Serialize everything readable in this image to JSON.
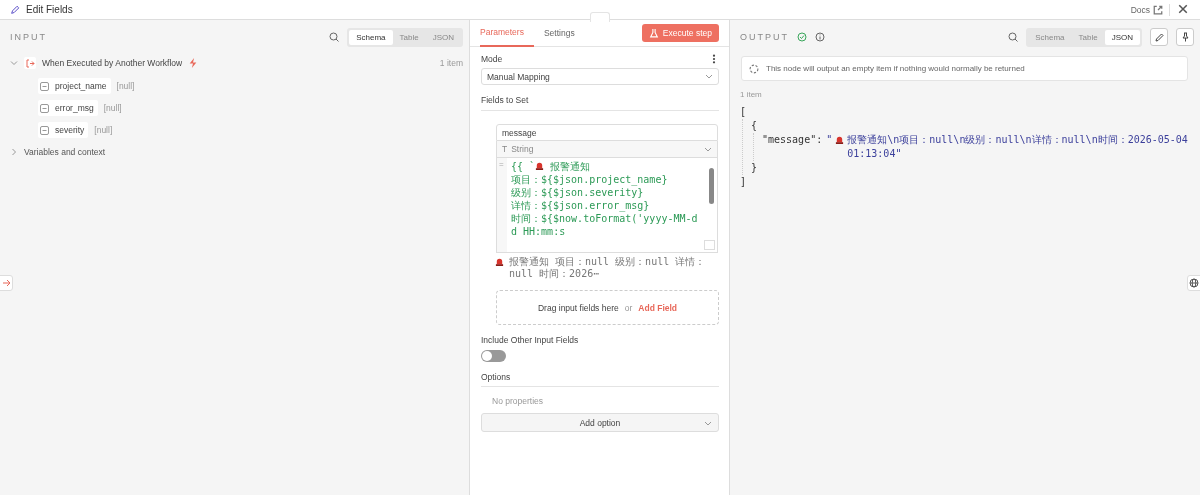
{
  "header": {
    "title": "Edit Fields",
    "docs": "Docs"
  },
  "input": {
    "title": "INPUT",
    "views": [
      {
        "label": "Schema",
        "selected": true
      },
      {
        "label": "Table",
        "selected": false
      },
      {
        "label": "JSON",
        "selected": false
      }
    ],
    "node": {
      "name": "When Executed by Another Workflow",
      "count": "1 item",
      "expanded": true,
      "fields": [
        {
          "name": "project_name",
          "value": "[null]"
        },
        {
          "name": "error_msg",
          "value": "[null]"
        },
        {
          "name": "severity",
          "value": "[null]"
        }
      ]
    },
    "context": {
      "label": "Variables and context",
      "expanded": false
    }
  },
  "parameters": {
    "tabs": [
      {
        "label": "Parameters",
        "selected": true
      },
      {
        "label": "Settings",
        "selected": false
      }
    ],
    "execute": "Execute step",
    "mode_label": "Mode",
    "mode_value": "Manual Mapping",
    "fields_label": "Fields to Set",
    "assignment": {
      "name": "message",
      "type_icon": "T",
      "type": "String",
      "eq": "=",
      "code_lines": [
        {
          "kind": "alert",
          "before": "{{ `",
          "text": "报警通知"
        },
        {
          "text": "项目：${$json.project_name}"
        },
        {
          "text": "级别：${$json.severity}"
        },
        {
          "text": "详情：${$json.error_msg}"
        },
        {
          "text": "时间：${$now.toFormat('yyyy-MM-dd HH:mm:s"
        }
      ],
      "preview": {
        "kind": "alert",
        "text": "报警通知 项目：null 级别：null 详情：null 时间：2026⋯"
      }
    },
    "drop_text": "Drag input fields here",
    "or": "or",
    "add_field": "Add Field",
    "include_label": "Include Other Input Fields",
    "include_on": false,
    "options_label": "Options",
    "no_properties": "No properties",
    "add_option": "Add option"
  },
  "output": {
    "title": "OUTPUT",
    "views": [
      {
        "label": "Schema",
        "selected": false
      },
      {
        "label": "Table",
        "selected": false
      },
      {
        "label": "JSON",
        "selected": true
      }
    ],
    "notice": "This node will output an empty item if nothing would normally be returned",
    "count": "1 item",
    "json": {
      "open": "[",
      "close": "]",
      "children": [
        {
          "open": "{",
          "close": "}",
          "children": [
            {
              "key": "\"message\":",
              "kind": "alert",
              "before": "\"",
              "text": "报警通知\\n项目：null\\n级别：null\\n详情：null\\n时间：2026-05-04 01:13:04\""
            }
          ]
        }
      ]
    }
  }
}
